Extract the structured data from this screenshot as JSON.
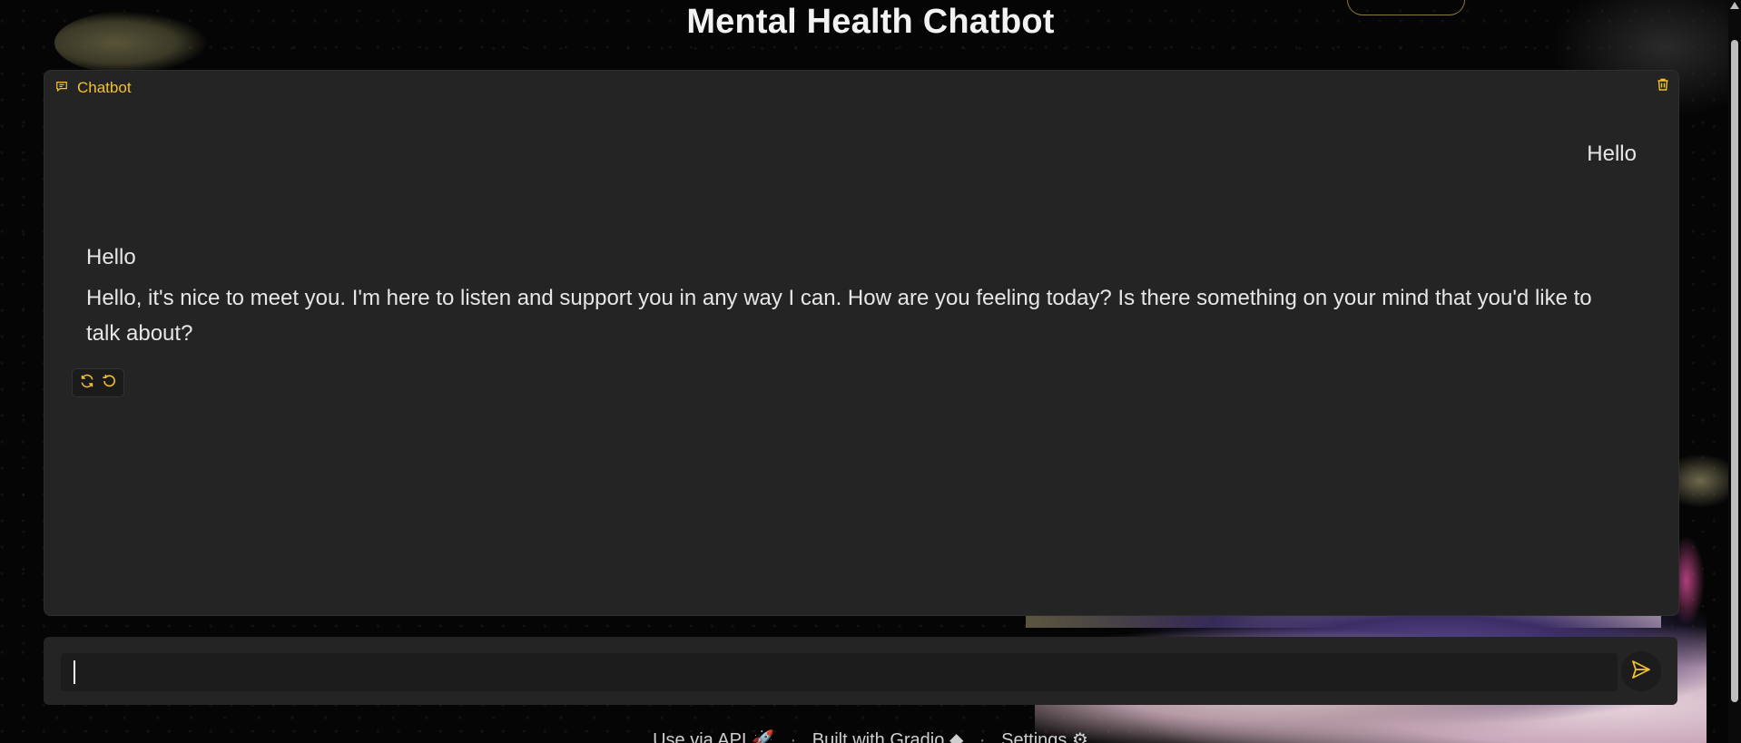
{
  "page": {
    "title": "Mental Health Chatbot"
  },
  "chatbot": {
    "label": "Chatbot",
    "label_icon": "chat-bubble-icon",
    "clear_icon": "trash-icon",
    "messages": [
      {
        "role": "user",
        "text": "Hello"
      },
      {
        "role": "bot",
        "lines": [
          "Hello",
          "Hello, it's nice to meet you. I'm here to listen and support you in any way I can. How are you feeling today? Is there something on your mind that you'd like to talk about?"
        ]
      }
    ],
    "actions": [
      {
        "name": "retry",
        "icon": "refresh-icon"
      },
      {
        "name": "undo",
        "icon": "undo-icon"
      }
    ]
  },
  "input": {
    "value": "",
    "placeholder": "",
    "send_icon": "send-icon"
  },
  "footer": {
    "api_label": "Use via API",
    "api_icon": "rocket-icon",
    "separator": "·",
    "built_label": "Built with Gradio",
    "built_icon": "gradio-logo-icon",
    "settings_label": "Settings",
    "settings_icon": "gear-icon"
  },
  "colors": {
    "accent": "#f2c12e",
    "panel": "#242424",
    "background": "#050505"
  }
}
